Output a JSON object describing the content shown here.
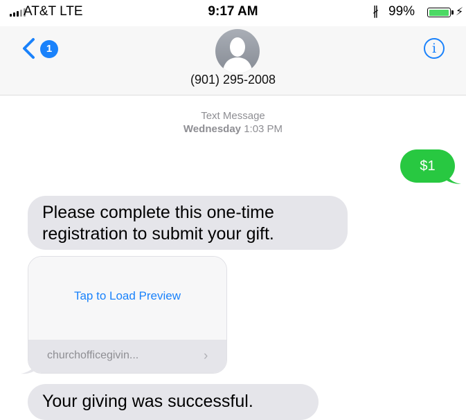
{
  "status_bar": {
    "carrier": "AT&T  LTE",
    "time": "9:17 AM",
    "battery_percent": "99%",
    "battery_level": 0.99,
    "bluetooth_icon": "bluetooth-icon",
    "charging_icon": "lightning-icon"
  },
  "nav": {
    "unread_count": "1",
    "contact_number": "(901) 295-2008",
    "info_symbol": "i",
    "back_icon": "chevron-left-icon",
    "avatar_icon": "person-silhouette-icon"
  },
  "conversation": {
    "service_label": "Text Message",
    "timestamp_day": "Wednesday",
    "timestamp_time": "1:03 PM",
    "messages": [
      {
        "direction": "sent",
        "text": "$1"
      },
      {
        "direction": "received",
        "text": "Please complete this one-time registration to submit your gift."
      },
      {
        "direction": "received",
        "type": "link",
        "preview_text": "Tap to Load Preview",
        "domain": "churchofficegivin...",
        "chevron": "›"
      },
      {
        "direction": "received",
        "text": "Your giving was successful."
      }
    ]
  },
  "colors": {
    "accent_blue": "#1a82fb",
    "sent_bubble": "#28c841",
    "received_bubble": "#e5e5ea",
    "battery_fill": "#4cd964",
    "secondary_text": "#8e8e93"
  }
}
